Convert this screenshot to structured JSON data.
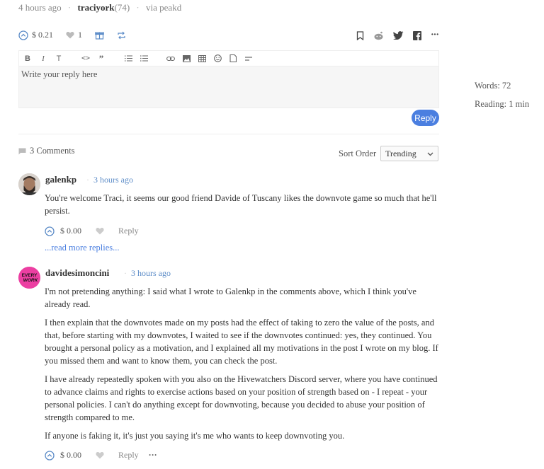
{
  "post_meta": {
    "time": "4 hours ago",
    "author": "traciyork",
    "reputation": "(74)",
    "via": "via peakd"
  },
  "post_actions": {
    "payout": "$ 0.21",
    "votes": "1"
  },
  "editor": {
    "placeholder": "Write your reply here",
    "reply_label": "Reply"
  },
  "stats": {
    "words": "Words: 72",
    "reading": "Reading: 1 min"
  },
  "comments_header": {
    "count_label": "3 Comments",
    "sort_label": "Sort Order",
    "sort_value": "Trending"
  },
  "comments": [
    {
      "author": "galenkp",
      "time": "3 hours ago",
      "paragraphs": [
        "You're welcome Traci, it seems our good friend Davide of Tuscany likes the downvote game so much that he'll persist."
      ],
      "payout": "$ 0.00",
      "reply_label": "Reply",
      "more_label": "...read more replies..."
    },
    {
      "author": "davidesimoncini",
      "time": "3 hours ago",
      "avatar_text": "EVERY WORK",
      "paragraphs": [
        "I'm not pretending anything: I said what I wrote to Galenkp in the comments above, which I think you've already read.",
        "I then explain that the downvotes made on my posts had the effect of taking to zero the value of the posts, and that, before starting with my downvotes, I waited to see if the downvotes continued: yes, they continued. You brought a personal policy as a motivation, and I explained all my motivations in the post I wrote on my blog. If you missed them and want to know them, you can check the post.",
        "I have already repeatedly spoken with you also on the Hivewatchers Discord server, where you have continued to advance claims and rights to exercise actions based on your position of strength based on - I repeat - your personal policies. I can't do anything except for downvoting, because you decided to abuse your position of strength compared to me.",
        "If anyone is faking it, it's just you saying it's me who wants to keep downvoting you."
      ],
      "payout": "$ 0.00",
      "reply_label": "Reply",
      "options_label": "···"
    }
  ]
}
